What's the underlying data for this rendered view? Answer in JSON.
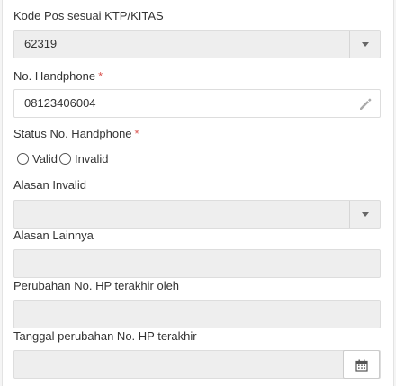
{
  "form": {
    "postal_code": {
      "label": "Kode Pos sesuai KTP/KITAS",
      "value": "62319"
    },
    "phone": {
      "label": "No. Handphone",
      "required_mark": "*",
      "value": "08123406004"
    },
    "phone_status": {
      "label": "Status No. Handphone",
      "required_mark": "*",
      "options": [
        "Valid",
        "Invalid"
      ]
    },
    "invalid_reason": {
      "label": "Alasan Invalid",
      "value": ""
    },
    "other_reason": {
      "label": "Alasan Lainnya",
      "value": ""
    },
    "last_changed_by": {
      "label": "Perubahan No. HP terakhir oleh",
      "value": ""
    },
    "last_changed_date": {
      "label": "Tanggal perubahan No. HP terakhir",
      "value": ""
    }
  },
  "icons": {
    "select_arrow": "chevron-down-icon",
    "edit": "pencil-icon",
    "calendar": "calendar-icon"
  },
  "colors": {
    "disabled_bg": "#eeeeee",
    "required": "#d9534f",
    "border": "#dddddd"
  }
}
